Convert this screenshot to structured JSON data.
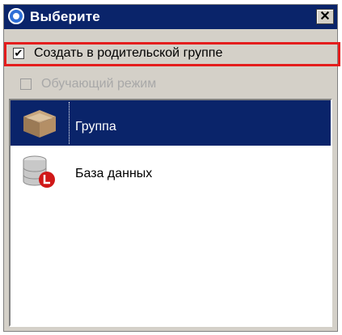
{
  "window": {
    "title": "Выберите",
    "close_glyph": "✕"
  },
  "options": {
    "create_in_parent": {
      "label": "Создать в родительской группе",
      "checked": true,
      "check_glyph": "✔"
    },
    "learning_mode": {
      "label": "Обучающий режим",
      "checked": false,
      "enabled": false
    }
  },
  "list": {
    "items": [
      {
        "label": "Группа",
        "icon": "folder-box-icon",
        "selected": true
      },
      {
        "label": "База данных",
        "icon": "database-icon",
        "selected": false
      }
    ]
  },
  "colors": {
    "titlebar": "#0a246a",
    "selection": "#0a246a",
    "highlight_border": "#e41d1d",
    "window_bg": "#d4d0c8"
  }
}
